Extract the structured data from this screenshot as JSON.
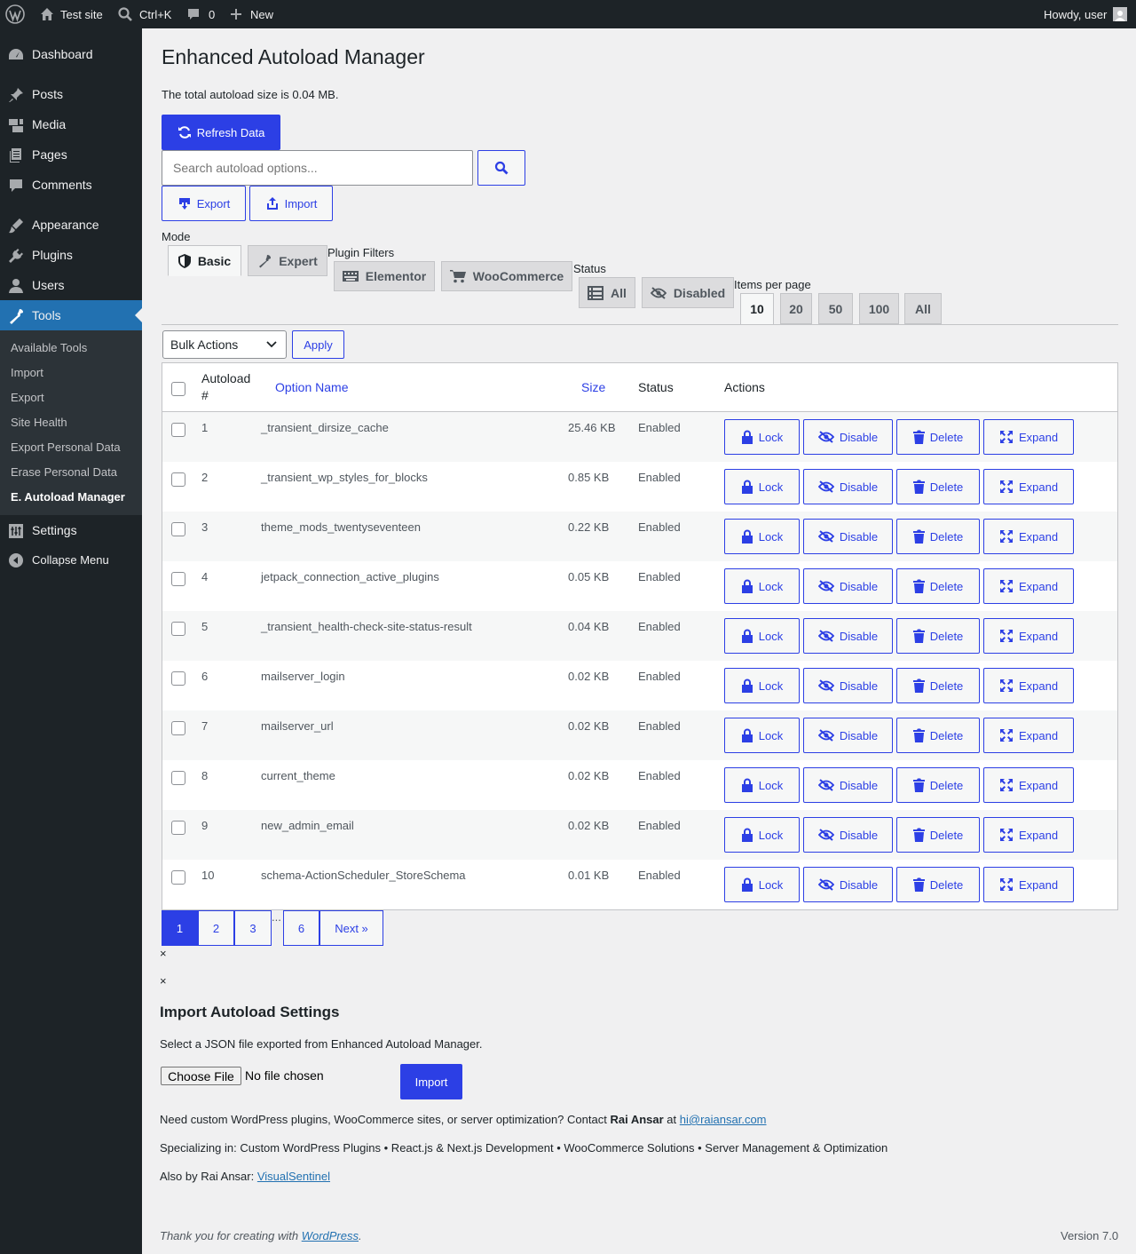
{
  "adminbar": {
    "site_name": "Test site",
    "search_shortcut": "Ctrl+K",
    "comments_count": "0",
    "new_label": "New",
    "howdy": "Howdy, user"
  },
  "sidebar": {
    "items": [
      {
        "label": "Dashboard",
        "icon": "dashboard-icon"
      },
      {
        "label": "Posts",
        "icon": "pin-icon"
      },
      {
        "label": "Media",
        "icon": "media-icon"
      },
      {
        "label": "Pages",
        "icon": "pages-icon"
      },
      {
        "label": "Comments",
        "icon": "comment-icon"
      },
      {
        "label": "Appearance",
        "icon": "brush-icon"
      },
      {
        "label": "Plugins",
        "icon": "plug-icon"
      },
      {
        "label": "Users",
        "icon": "user-icon"
      },
      {
        "label": "Tools",
        "icon": "wrench-icon"
      },
      {
        "label": "Settings",
        "icon": "sliders-icon"
      },
      {
        "label": "Collapse Menu",
        "icon": "collapse-icon"
      }
    ],
    "submenu": [
      "Available Tools",
      "Import",
      "Export",
      "Site Health",
      "Export Personal Data",
      "Erase Personal Data",
      "E. Autoload Manager"
    ]
  },
  "main": {
    "title": "Enhanced Autoload Manager",
    "total_text": "The total autoload size is 0.04 MB.",
    "refresh_label": "Refresh Data",
    "search_placeholder": "Search autoload options...",
    "export_label": "Export",
    "import_label": "Import",
    "mode_label": "Mode",
    "mode_tabs": [
      "Basic",
      "Expert"
    ],
    "plugin_filters_label": "Plugin Filters",
    "plugin_tabs": [
      "Elementor",
      "WooCommerce"
    ],
    "status_label": "Status",
    "status_tabs": [
      "All",
      "Disabled"
    ],
    "items_per_page_label": "Items per page",
    "per_page_tabs": [
      "10",
      "20",
      "50",
      "100",
      "All"
    ],
    "bulk_actions": "Bulk Actions",
    "apply_label": "Apply"
  },
  "table": {
    "headers": {
      "autoload": "Autoload #",
      "option_name": "Option Name",
      "size": "Size",
      "status": "Status",
      "actions": "Actions"
    },
    "action_labels": [
      "Lock",
      "Disable",
      "Delete",
      "Expand"
    ],
    "rows": [
      {
        "num": "1",
        "name": "_transient_dirsize_cache",
        "size": "25.46 KB",
        "status": "Enabled"
      },
      {
        "num": "2",
        "name": "_transient_wp_styles_for_blocks",
        "size": "0.85 KB",
        "status": "Enabled"
      },
      {
        "num": "3",
        "name": "theme_mods_twentyseventeen",
        "size": "0.22 KB",
        "status": "Enabled"
      },
      {
        "num": "4",
        "name": "jetpack_connection_active_plugins",
        "size": "0.05 KB",
        "status": "Enabled"
      },
      {
        "num": "5",
        "name": "_transient_health-check-site-status-result",
        "size": "0.04 KB",
        "status": "Enabled"
      },
      {
        "num": "6",
        "name": "mailserver_login",
        "size": "0.02 KB",
        "status": "Enabled"
      },
      {
        "num": "7",
        "name": "mailserver_url",
        "size": "0.02 KB",
        "status": "Enabled"
      },
      {
        "num": "8",
        "name": "current_theme",
        "size": "0.02 KB",
        "status": "Enabled"
      },
      {
        "num": "9",
        "name": "new_admin_email",
        "size": "0.02 KB",
        "status": "Enabled"
      },
      {
        "num": "10",
        "name": "schema-ActionScheduler_StoreSchema",
        "size": "0.01 KB",
        "status": "Enabled"
      }
    ]
  },
  "pagination": {
    "pages": [
      "1",
      "2",
      "3",
      "6"
    ],
    "ellipsis": "...",
    "next": "Next »"
  },
  "close_glyph": "×",
  "import_section": {
    "title": "Import Autoload Settings",
    "description": "Select a JSON file exported from Enhanced Autoload Manager.",
    "choose_file": "Choose File",
    "no_file": "No file chosen",
    "import_button": "Import"
  },
  "credits": {
    "line1_prefix": "Need custom WordPress plugins, WooCommerce sites, or server optimization? Contact",
    "author": "Rai Ansar",
    "at": "at",
    "email": "hi@raiansar.com",
    "line2": "Specializing in: Custom WordPress Plugins • React.js & Next.js Development • WooCommerce Solutions • Server Management & Optimization",
    "line3_prefix": "Also by Rai Ansar:",
    "line3_link": "VisualSentinel"
  },
  "footer": {
    "thanks_prefix": "Thank you for creating with",
    "thanks_link": "WordPress",
    "thanks_suffix": ".",
    "version": "Version 7.0"
  },
  "colors": {
    "accent": "#2c3fe5",
    "admin_dark": "#1d2327",
    "wp_blue": "#2271b1"
  }
}
